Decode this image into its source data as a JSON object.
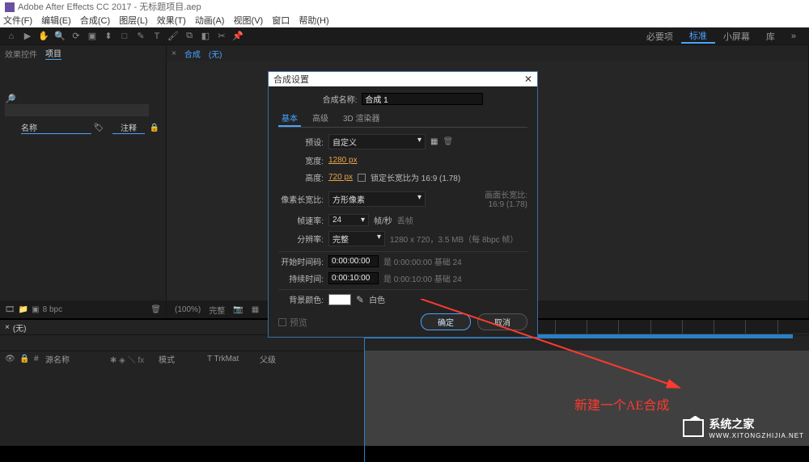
{
  "app": {
    "title": "Adobe After Effects CC 2017 - 无标题项目.aep"
  },
  "menu": {
    "items": [
      "文件(F)",
      "编辑(E)",
      "合成(C)",
      "图层(L)",
      "效果(T)",
      "动画(A)",
      "视图(V)",
      "窗口",
      "帮助(H)"
    ]
  },
  "workspaces": {
    "items": [
      "必要项",
      "标准",
      "小屏幕",
      "库"
    ],
    "active": "标准"
  },
  "project_panel": {
    "tab1": "效果控件",
    "tab2": "项目",
    "col_name": "名称",
    "col_comment": "注释",
    "search_placeholder": ""
  },
  "viewer": {
    "tab1": "合成",
    "tab2": "(无)",
    "footer_zoom": "(100%)",
    "footer_res": "完整"
  },
  "timeline": {
    "tab": "(无)",
    "time": "",
    "col_source": "源名称",
    "col_mode": "模式",
    "col_trkmat": "T  TrkMat",
    "col_parent": "父级"
  },
  "dialog": {
    "title": "合成设置",
    "name_label": "合成名称:",
    "name_value": "合成 1",
    "tab_basic": "基本",
    "tab_adv": "高级",
    "tab_3d": "3D 渲染器",
    "preset_label": "预设:",
    "preset_value": "自定义",
    "width_label": "宽度:",
    "width_value": "1280 px",
    "height_label": "高度:",
    "height_value": "720 px",
    "lock_ar": "锁定长宽比为 16:9 (1.78)",
    "par_label": "像素长宽比:",
    "par_value": "方形像素",
    "frame_ar_label": "画面长宽比:",
    "frame_ar_value": "16:9 (1.78)",
    "fps_label": "帧速率:",
    "fps_value": "24",
    "fps_unit": "帧/秒",
    "fps_drop": "丢帧",
    "res_label": "分辨率:",
    "res_value": "完整",
    "res_info": "1280 x 720，3.5 MB（每 8bpc 帧）",
    "start_label": "开始时间码:",
    "start_value": "0:00:00:00",
    "start_info": "是 0:00:00:00 基础 24",
    "dur_label": "持续时间:",
    "dur_value": "0:00:10:00",
    "dur_info": "是 0:00:10:00 基础 24",
    "bg_label": "背景颜色:",
    "bg_name": "白色",
    "preview": "预览",
    "ok": "确定",
    "cancel": "取消"
  },
  "annotation": {
    "text": "新建一个AE合成"
  },
  "watermark": {
    "name": "系统之家",
    "url": "WWW.XITONGZHIJIA.NET"
  },
  "bottom_bar": {
    "bpc": "8 bpc"
  }
}
